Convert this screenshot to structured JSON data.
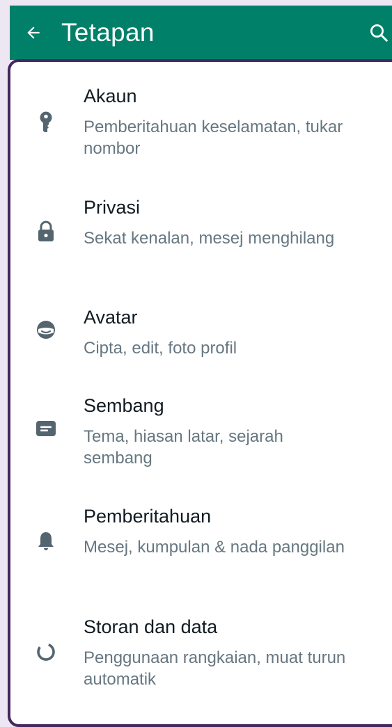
{
  "header": {
    "title": "Tetapan",
    "back_icon": "arrow-left-icon",
    "search_icon": "search-icon"
  },
  "colors": {
    "appbar": "#008069",
    "panel_border": "#43285e",
    "title_text": "#111b21",
    "subtitle_text": "#667781",
    "icon": "#54656f"
  },
  "settings": {
    "items": [
      {
        "title": "Akaun",
        "subtitle": "Pemberitahuan keselamatan, tukar nombor",
        "icon": "key-icon"
      },
      {
        "title": "Privasi",
        "subtitle": "Sekat kenalan, mesej menghilang",
        "icon": "lock-icon"
      },
      {
        "title": "Avatar",
        "subtitle": "Cipta, edit, foto profil",
        "icon": "avatar-icon"
      },
      {
        "title": "Sembang",
        "subtitle": "Tema, hiasan latar, sejarah sembang",
        "icon": "chat-icon"
      },
      {
        "title": "Pemberitahuan",
        "subtitle": "Mesej, kumpulan & nada panggilan",
        "icon": "bell-icon"
      },
      {
        "title": "Storan dan data",
        "subtitle": "Penggunaan rangkaian, muat turun automatik",
        "icon": "storage-icon"
      }
    ]
  }
}
